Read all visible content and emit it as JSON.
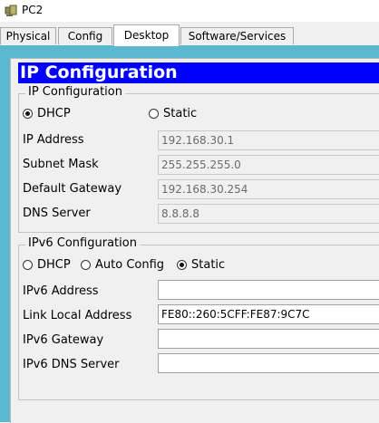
{
  "window": {
    "title": "PC2",
    "icon": "pc-app-icon"
  },
  "tabs": [
    {
      "label": "Physical"
    },
    {
      "label": "Config"
    },
    {
      "label": "Desktop"
    },
    {
      "label": "Software/Services"
    }
  ],
  "active_tab": "Desktop",
  "ipconfig": {
    "header": "IP Configuration",
    "ipv4": {
      "group_label": "IP Configuration",
      "dhcp_label": "DHCP",
      "static_label": "Static",
      "selected": "DHCP",
      "ip_label": "IP Address",
      "ip_value": "192.168.30.1",
      "subnet_label": "Subnet Mask",
      "subnet_value": "255.255.255.0",
      "gateway_label": "Default Gateway",
      "gateway_value": "192.168.30.254",
      "dns_label": "DNS Server",
      "dns_value": "8.8.8.8"
    },
    "ipv6": {
      "group_label": "IPv6 Configuration",
      "dhcp_label": "DHCP",
      "auto_label": "Auto Config",
      "static_label": "Static",
      "selected": "Static",
      "address_label": "IPv6 Address",
      "address_value": "",
      "link_local_label": "Link Local Address",
      "link_local_value": "FE80::260:5CFF:FE87:9C7C",
      "gateway_label": "IPv6 Gateway",
      "gateway_value": "",
      "dns_label": "IPv6 DNS Server",
      "dns_value": ""
    }
  },
  "colors": {
    "header_bg": "#0000ff",
    "desktop_bg": "#5bb8cf"
  }
}
